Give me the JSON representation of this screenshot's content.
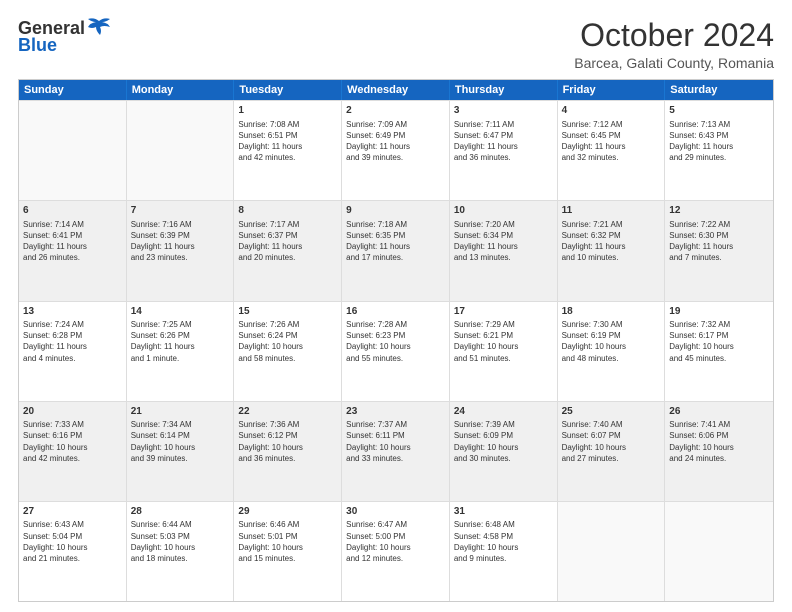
{
  "logo": {
    "general": "General",
    "blue": "Blue"
  },
  "title": "October 2024",
  "subtitle": "Barcea, Galati County, Romania",
  "header_days": [
    "Sunday",
    "Monday",
    "Tuesday",
    "Wednesday",
    "Thursday",
    "Friday",
    "Saturday"
  ],
  "rows": [
    [
      {
        "day": "",
        "lines": [],
        "empty": true
      },
      {
        "day": "",
        "lines": [],
        "empty": true
      },
      {
        "day": "1",
        "lines": [
          "Sunrise: 7:08 AM",
          "Sunset: 6:51 PM",
          "Daylight: 11 hours",
          "and 42 minutes."
        ]
      },
      {
        "day": "2",
        "lines": [
          "Sunrise: 7:09 AM",
          "Sunset: 6:49 PM",
          "Daylight: 11 hours",
          "and 39 minutes."
        ]
      },
      {
        "day": "3",
        "lines": [
          "Sunrise: 7:11 AM",
          "Sunset: 6:47 PM",
          "Daylight: 11 hours",
          "and 36 minutes."
        ]
      },
      {
        "day": "4",
        "lines": [
          "Sunrise: 7:12 AM",
          "Sunset: 6:45 PM",
          "Daylight: 11 hours",
          "and 32 minutes."
        ]
      },
      {
        "day": "5",
        "lines": [
          "Sunrise: 7:13 AM",
          "Sunset: 6:43 PM",
          "Daylight: 11 hours",
          "and 29 minutes."
        ]
      }
    ],
    [
      {
        "day": "6",
        "lines": [
          "Sunrise: 7:14 AM",
          "Sunset: 6:41 PM",
          "Daylight: 11 hours",
          "and 26 minutes."
        ],
        "shaded": true
      },
      {
        "day": "7",
        "lines": [
          "Sunrise: 7:16 AM",
          "Sunset: 6:39 PM",
          "Daylight: 11 hours",
          "and 23 minutes."
        ],
        "shaded": true
      },
      {
        "day": "8",
        "lines": [
          "Sunrise: 7:17 AM",
          "Sunset: 6:37 PM",
          "Daylight: 11 hours",
          "and 20 minutes."
        ],
        "shaded": true
      },
      {
        "day": "9",
        "lines": [
          "Sunrise: 7:18 AM",
          "Sunset: 6:35 PM",
          "Daylight: 11 hours",
          "and 17 minutes."
        ],
        "shaded": true
      },
      {
        "day": "10",
        "lines": [
          "Sunrise: 7:20 AM",
          "Sunset: 6:34 PM",
          "Daylight: 11 hours",
          "and 13 minutes."
        ],
        "shaded": true
      },
      {
        "day": "11",
        "lines": [
          "Sunrise: 7:21 AM",
          "Sunset: 6:32 PM",
          "Daylight: 11 hours",
          "and 10 minutes."
        ],
        "shaded": true
      },
      {
        "day": "12",
        "lines": [
          "Sunrise: 7:22 AM",
          "Sunset: 6:30 PM",
          "Daylight: 11 hours",
          "and 7 minutes."
        ],
        "shaded": true
      }
    ],
    [
      {
        "day": "13",
        "lines": [
          "Sunrise: 7:24 AM",
          "Sunset: 6:28 PM",
          "Daylight: 11 hours",
          "and 4 minutes."
        ]
      },
      {
        "day": "14",
        "lines": [
          "Sunrise: 7:25 AM",
          "Sunset: 6:26 PM",
          "Daylight: 11 hours",
          "and 1 minute."
        ]
      },
      {
        "day": "15",
        "lines": [
          "Sunrise: 7:26 AM",
          "Sunset: 6:24 PM",
          "Daylight: 10 hours",
          "and 58 minutes."
        ]
      },
      {
        "day": "16",
        "lines": [
          "Sunrise: 7:28 AM",
          "Sunset: 6:23 PM",
          "Daylight: 10 hours",
          "and 55 minutes."
        ]
      },
      {
        "day": "17",
        "lines": [
          "Sunrise: 7:29 AM",
          "Sunset: 6:21 PM",
          "Daylight: 10 hours",
          "and 51 minutes."
        ]
      },
      {
        "day": "18",
        "lines": [
          "Sunrise: 7:30 AM",
          "Sunset: 6:19 PM",
          "Daylight: 10 hours",
          "and 48 minutes."
        ]
      },
      {
        "day": "19",
        "lines": [
          "Sunrise: 7:32 AM",
          "Sunset: 6:17 PM",
          "Daylight: 10 hours",
          "and 45 minutes."
        ]
      }
    ],
    [
      {
        "day": "20",
        "lines": [
          "Sunrise: 7:33 AM",
          "Sunset: 6:16 PM",
          "Daylight: 10 hours",
          "and 42 minutes."
        ],
        "shaded": true
      },
      {
        "day": "21",
        "lines": [
          "Sunrise: 7:34 AM",
          "Sunset: 6:14 PM",
          "Daylight: 10 hours",
          "and 39 minutes."
        ],
        "shaded": true
      },
      {
        "day": "22",
        "lines": [
          "Sunrise: 7:36 AM",
          "Sunset: 6:12 PM",
          "Daylight: 10 hours",
          "and 36 minutes."
        ],
        "shaded": true
      },
      {
        "day": "23",
        "lines": [
          "Sunrise: 7:37 AM",
          "Sunset: 6:11 PM",
          "Daylight: 10 hours",
          "and 33 minutes."
        ],
        "shaded": true
      },
      {
        "day": "24",
        "lines": [
          "Sunrise: 7:39 AM",
          "Sunset: 6:09 PM",
          "Daylight: 10 hours",
          "and 30 minutes."
        ],
        "shaded": true
      },
      {
        "day": "25",
        "lines": [
          "Sunrise: 7:40 AM",
          "Sunset: 6:07 PM",
          "Daylight: 10 hours",
          "and 27 minutes."
        ],
        "shaded": true
      },
      {
        "day": "26",
        "lines": [
          "Sunrise: 7:41 AM",
          "Sunset: 6:06 PM",
          "Daylight: 10 hours",
          "and 24 minutes."
        ],
        "shaded": true
      }
    ],
    [
      {
        "day": "27",
        "lines": [
          "Sunrise: 6:43 AM",
          "Sunset: 5:04 PM",
          "Daylight: 10 hours",
          "and 21 minutes."
        ]
      },
      {
        "day": "28",
        "lines": [
          "Sunrise: 6:44 AM",
          "Sunset: 5:03 PM",
          "Daylight: 10 hours",
          "and 18 minutes."
        ]
      },
      {
        "day": "29",
        "lines": [
          "Sunrise: 6:46 AM",
          "Sunset: 5:01 PM",
          "Daylight: 10 hours",
          "and 15 minutes."
        ]
      },
      {
        "day": "30",
        "lines": [
          "Sunrise: 6:47 AM",
          "Sunset: 5:00 PM",
          "Daylight: 10 hours",
          "and 12 minutes."
        ]
      },
      {
        "day": "31",
        "lines": [
          "Sunrise: 6:48 AM",
          "Sunset: 4:58 PM",
          "Daylight: 10 hours",
          "and 9 minutes."
        ]
      },
      {
        "day": "",
        "lines": [],
        "empty": true
      },
      {
        "day": "",
        "lines": [],
        "empty": true
      }
    ]
  ]
}
